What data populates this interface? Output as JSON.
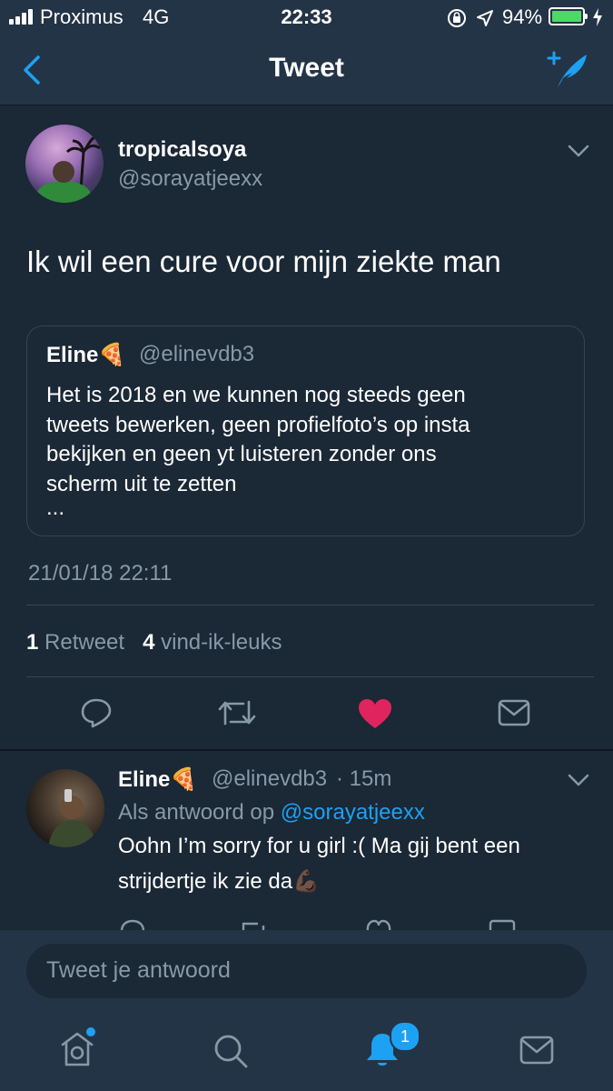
{
  "status_bar": {
    "carrier": "Proximus",
    "network": "4G",
    "time": "22:33",
    "battery_percent": "94%",
    "battery_level": 0.94
  },
  "nav": {
    "title": "Tweet"
  },
  "tweet": {
    "author_name": "tropicalsoya",
    "author_handle": "@sorayatjeexx",
    "text": "Ik wil een cure voor mijn ziekte man",
    "quoted": {
      "author_name": "Eline🍕",
      "author_handle": "@elinevdb3",
      "text_lines": [
        "Het is 2018 en we kunnen nog steeds geen",
        "tweets bewerken, geen profielfoto’s op insta",
        "bekijken en geen yt luisteren zonder ons",
        "scherm uit te zetten",
        "..."
      ]
    },
    "timestamp": "21/01/18 22:11",
    "retweet_count": "1",
    "retweet_label": "Retweet",
    "like_count": "4",
    "like_label": "vind-ik-leuks",
    "liked": true
  },
  "reply": {
    "author_name": "Eline🍕",
    "author_handle": "@elinevdb3",
    "age": "· 15m",
    "in_reply_prefix": "Als antwoord op",
    "in_reply_handle": "@sorayatjeexx",
    "text_line1": "Oohn I’m sorry for u girl :( Ma gij bent een",
    "text_line2": "strijdertje ik zie da💪🏿"
  },
  "compose": {
    "placeholder": "Tweet je antwoord"
  },
  "tab_bar": {
    "items": [
      "home-icon",
      "search-icon",
      "notifications-icon",
      "messages-icon"
    ],
    "notifications_badge": "1"
  },
  "colors": {
    "background": "#1b2836",
    "bar": "#243447",
    "accent": "#1da1f2",
    "like": "#e0245e",
    "secondary_text": "#8899a6",
    "battery": "#4cd964"
  }
}
